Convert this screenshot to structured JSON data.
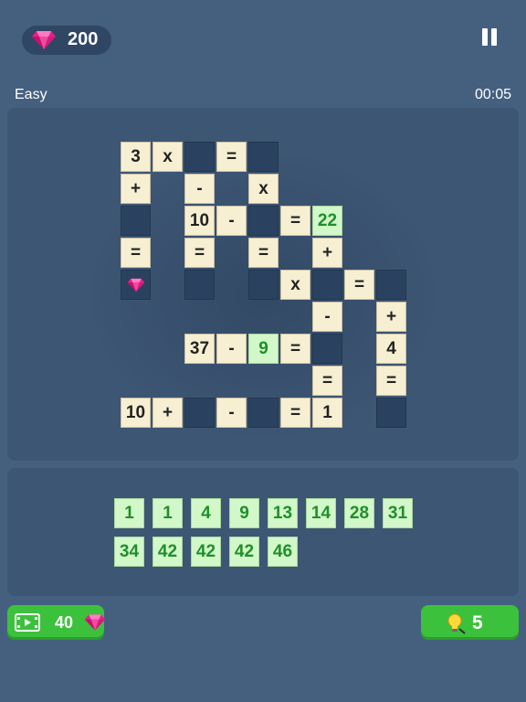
{
  "header": {
    "gems": "200",
    "pause_icon": "pause-icon",
    "difficulty": "Easy",
    "timer": "00:05"
  },
  "board": {
    "cells": [
      {
        "row": 0,
        "col": 0,
        "state": "given",
        "value": "3"
      },
      {
        "row": 0,
        "col": 1,
        "state": "given",
        "value": "x"
      },
      {
        "row": 0,
        "col": 2,
        "state": "empty",
        "value": ""
      },
      {
        "row": 0,
        "col": 3,
        "state": "given",
        "value": "="
      },
      {
        "row": 0,
        "col": 4,
        "state": "empty",
        "value": ""
      },
      {
        "row": 1,
        "col": 0,
        "state": "given",
        "value": "+"
      },
      {
        "row": 1,
        "col": 2,
        "state": "given",
        "value": "-"
      },
      {
        "row": 1,
        "col": 4,
        "state": "given",
        "value": "x"
      },
      {
        "row": 2,
        "col": 0,
        "state": "empty",
        "value": ""
      },
      {
        "row": 2,
        "col": 2,
        "state": "given",
        "value": "10"
      },
      {
        "row": 2,
        "col": 3,
        "state": "given",
        "value": "-"
      },
      {
        "row": 2,
        "col": 4,
        "state": "empty",
        "value": ""
      },
      {
        "row": 2,
        "col": 5,
        "state": "given",
        "value": "="
      },
      {
        "row": 2,
        "col": 6,
        "state": "placed",
        "value": "22"
      },
      {
        "row": 3,
        "col": 0,
        "state": "given",
        "value": "="
      },
      {
        "row": 3,
        "col": 2,
        "state": "given",
        "value": "="
      },
      {
        "row": 3,
        "col": 4,
        "state": "given",
        "value": "="
      },
      {
        "row": 3,
        "col": 6,
        "state": "given",
        "value": "+"
      },
      {
        "row": 4,
        "col": 0,
        "state": "empty",
        "value": "",
        "gem": true
      },
      {
        "row": 4,
        "col": 2,
        "state": "empty",
        "value": ""
      },
      {
        "row": 4,
        "col": 4,
        "state": "empty",
        "value": ""
      },
      {
        "row": 4,
        "col": 5,
        "state": "given",
        "value": "x"
      },
      {
        "row": 4,
        "col": 6,
        "state": "empty",
        "value": ""
      },
      {
        "row": 4,
        "col": 7,
        "state": "given",
        "value": "="
      },
      {
        "row": 4,
        "col": 8,
        "state": "empty",
        "value": ""
      },
      {
        "row": 5,
        "col": 6,
        "state": "given",
        "value": "-"
      },
      {
        "row": 5,
        "col": 8,
        "state": "given",
        "value": "+"
      },
      {
        "row": 6,
        "col": 2,
        "state": "given",
        "value": "37"
      },
      {
        "row": 6,
        "col": 3,
        "state": "given",
        "value": "-"
      },
      {
        "row": 6,
        "col": 4,
        "state": "placed",
        "value": "9"
      },
      {
        "row": 6,
        "col": 5,
        "state": "given",
        "value": "="
      },
      {
        "row": 6,
        "col": 6,
        "state": "empty",
        "value": ""
      },
      {
        "row": 6,
        "col": 8,
        "state": "given",
        "value": "4"
      },
      {
        "row": 7,
        "col": 6,
        "state": "given",
        "value": "="
      },
      {
        "row": 7,
        "col": 8,
        "state": "given",
        "value": "="
      },
      {
        "row": 8,
        "col": 0,
        "state": "given",
        "value": "10"
      },
      {
        "row": 8,
        "col": 1,
        "state": "given",
        "value": "+"
      },
      {
        "row": 8,
        "col": 2,
        "state": "empty",
        "value": ""
      },
      {
        "row": 8,
        "col": 3,
        "state": "given",
        "value": "-"
      },
      {
        "row": 8,
        "col": 4,
        "state": "empty",
        "value": ""
      },
      {
        "row": 8,
        "col": 5,
        "state": "given",
        "value": "="
      },
      {
        "row": 8,
        "col": 6,
        "state": "given",
        "value": "1"
      },
      {
        "row": 8,
        "col": 8,
        "state": "empty",
        "value": ""
      }
    ]
  },
  "tray": {
    "rows": [
      [
        "1",
        "1",
        "4",
        "9",
        "13",
        "14",
        "28",
        "31"
      ],
      [
        "34",
        "42",
        "42",
        "42",
        "46"
      ]
    ]
  },
  "footer": {
    "video_icon": "film-icon",
    "video_cost": "40",
    "hint_icon": "lightbulb-icon",
    "hint_count": "5"
  },
  "colors": {
    "background": "#45607f",
    "panel": "#3d5674",
    "given_cell": "#f7efd2",
    "placed_cell": "#d2f7c8",
    "empty_cell": "#2a4260",
    "button_green": "#3cc13c",
    "gem_pink": "#e8208a"
  }
}
